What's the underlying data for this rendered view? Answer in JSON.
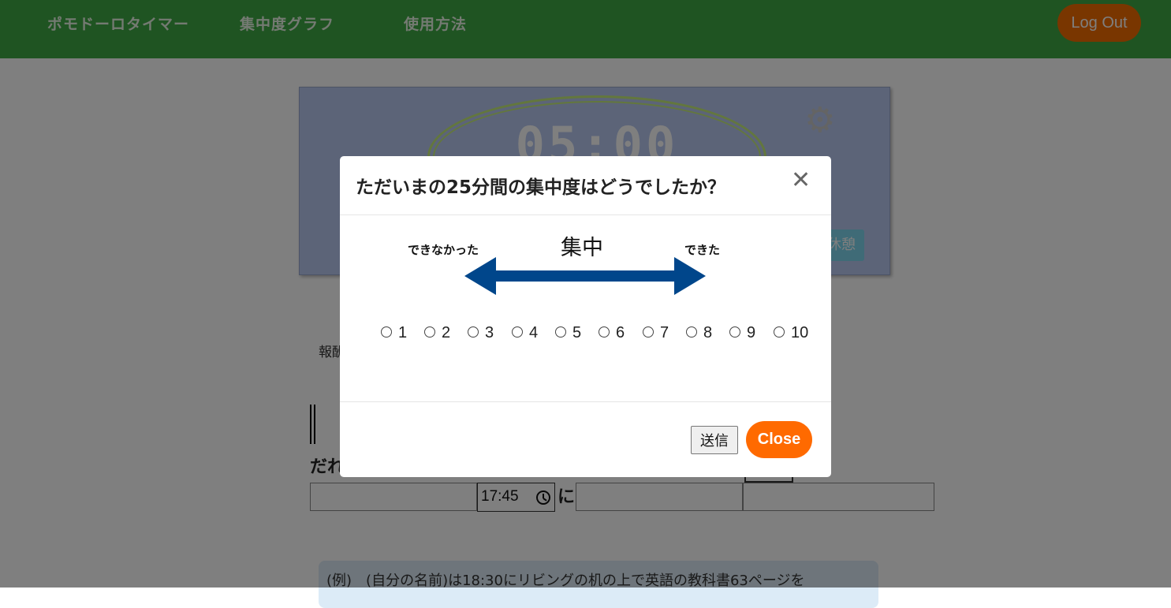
{
  "navbar": {
    "items": [
      {
        "label": "ポモドーロタイマー"
      },
      {
        "label": "集中度グラフ"
      },
      {
        "label": "使用方法"
      }
    ],
    "logout_label": "Log Out"
  },
  "timer": {
    "display": "05:00",
    "gear_icon": "gear-icon",
    "break_label": "休憩"
  },
  "form": {
    "report_label": "報酬",
    "who_label": "だれ",
    "time_value": "17:45",
    "ni_label": "に",
    "example_text": "(例)　(自分の名前)は18:30にリビングの机の上で英語の教科書63ページを"
  },
  "modal": {
    "title": "ただいまの25分間の集中度はどうでしたか？",
    "close_icon": "close-icon",
    "scale": {
      "low_label": "できなかった",
      "center_label": "集中",
      "high_label": "できた"
    },
    "options": [
      "1",
      "2",
      "3",
      "4",
      "5",
      "6",
      "7",
      "8",
      "9",
      "10"
    ],
    "submit_label": "送信",
    "close_label": "Close"
  },
  "colors": {
    "navbar": "#3fa845",
    "logout": "#f26c00",
    "close_button": "#ff6a00",
    "arrow": "#00468b",
    "timer_card": "#b8c8f0"
  }
}
